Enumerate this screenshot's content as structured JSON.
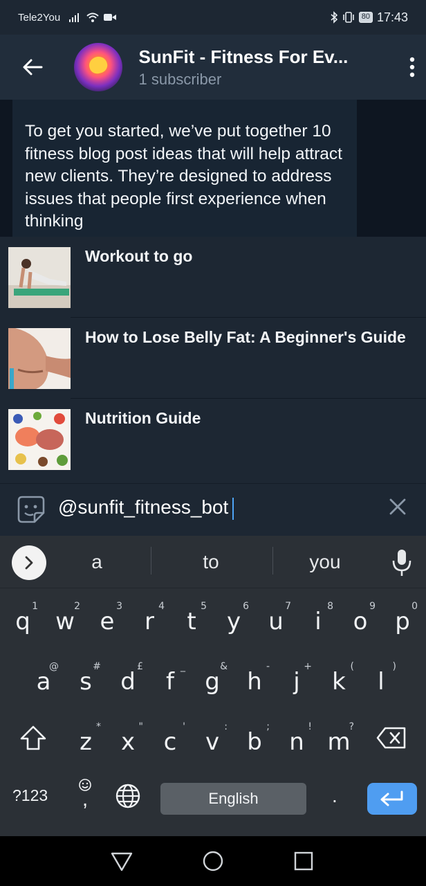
{
  "status_bar": {
    "carrier": "Tele2You",
    "battery": "80",
    "time": "17:43"
  },
  "header": {
    "title": "SunFit - Fitness For Ev...",
    "subtitle": "1 subscriber"
  },
  "message": {
    "text": "To get you started, we’ve put together 10 fitness blog post ideas that will help attract new clients. They’re designed to address issues that people first experience when thinking"
  },
  "inline_results": [
    {
      "title": "Workout to go"
    },
    {
      "title": "How to Lose Belly Fat: A Beginner's Guide"
    },
    {
      "title": "Nutrition Guide"
    }
  ],
  "input": {
    "value": "@sunfit_fitness_bot"
  },
  "keyboard": {
    "suggestions": [
      "a",
      "to",
      "you"
    ],
    "row1": [
      {
        "k": "q",
        "h": "1"
      },
      {
        "k": "w",
        "h": "2"
      },
      {
        "k": "e",
        "h": "3"
      },
      {
        "k": "r",
        "h": "4"
      },
      {
        "k": "t",
        "h": "5"
      },
      {
        "k": "y",
        "h": "6"
      },
      {
        "k": "u",
        "h": "7"
      },
      {
        "k": "i",
        "h": "8"
      },
      {
        "k": "o",
        "h": "9"
      },
      {
        "k": "p",
        "h": "0"
      }
    ],
    "row2": [
      {
        "k": "a",
        "h": "@"
      },
      {
        "k": "s",
        "h": "#"
      },
      {
        "k": "d",
        "h": "£"
      },
      {
        "k": "f",
        "h": "_"
      },
      {
        "k": "g",
        "h": "&"
      },
      {
        "k": "h",
        "h": "-"
      },
      {
        "k": "j",
        "h": "+"
      },
      {
        "k": "k",
        "h": "("
      },
      {
        "k": "l",
        "h": ")"
      }
    ],
    "row3": [
      {
        "k": "z",
        "h": "*"
      },
      {
        "k": "x",
        "h": "\""
      },
      {
        "k": "c",
        "h": "'"
      },
      {
        "k": "v",
        "h": ":"
      },
      {
        "k": "b",
        "h": ";"
      },
      {
        "k": "n",
        "h": "!"
      },
      {
        "k": "m",
        "h": "?"
      }
    ],
    "symbols_label": "?123",
    "comma_label": ",",
    "space_label": "English",
    "period_label": "."
  }
}
